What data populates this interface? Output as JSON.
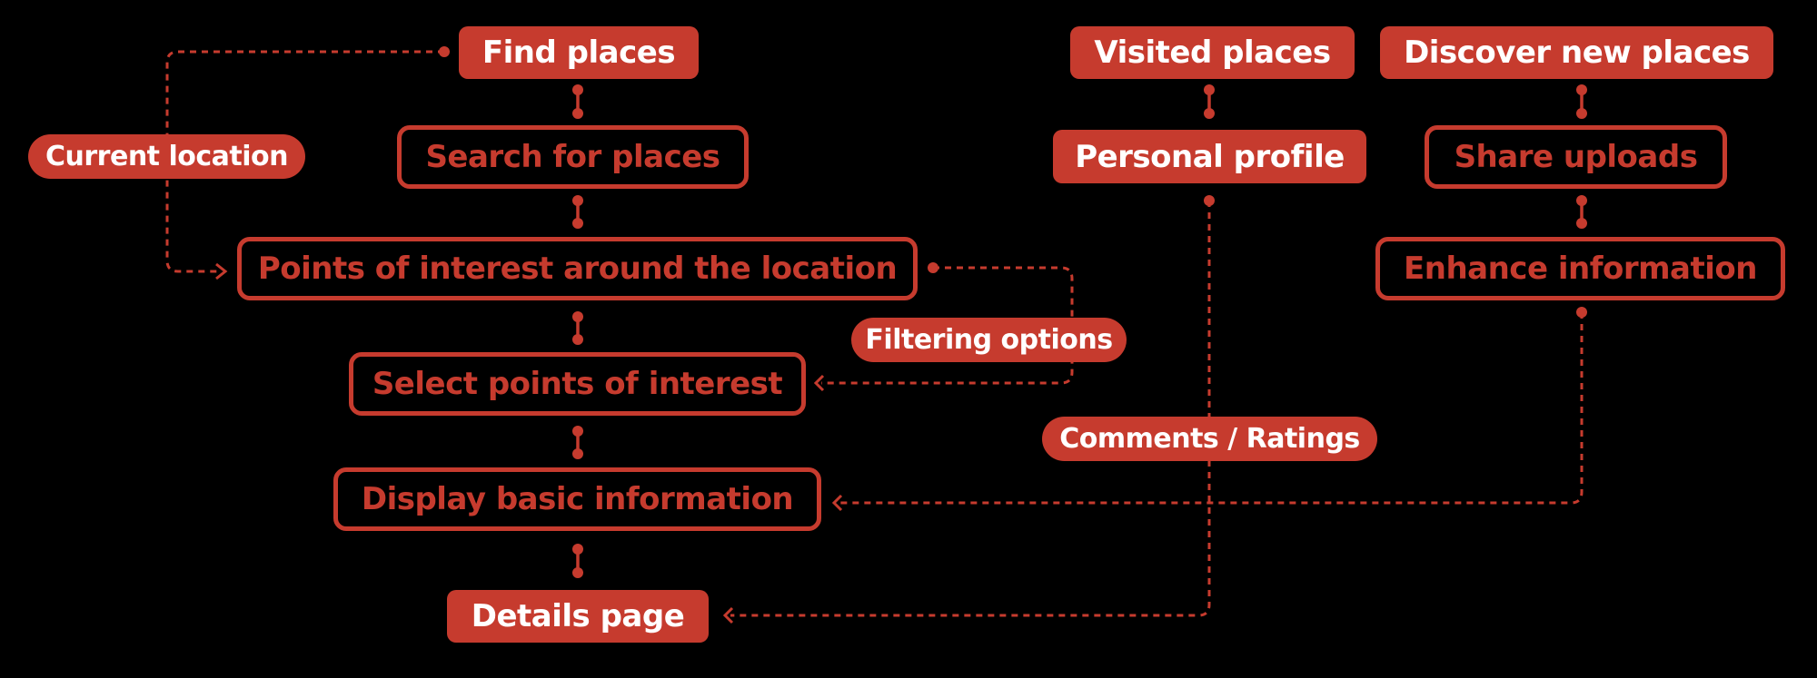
{
  "diagram": {
    "accent_color": "#c63b2e",
    "background_color": "#000000",
    "nodes": {
      "find_places": "Find places",
      "search_for_places": "Search for places",
      "points_of_interest": "Points of interest around the location",
      "select_points": "Select points of interest",
      "display_basic_info": "Display basic information",
      "details_page": "Details page",
      "visited_places": "Visited places",
      "personal_profile": "Personal profile",
      "discover_new_places": "Discover new places",
      "share_uploads": "Share uploads",
      "enhance_information": "Enhance information"
    },
    "labels": {
      "current_location": "Current location",
      "filtering_options": "Filtering options",
      "comments_ratings": "Comments / Ratings"
    },
    "edges": [
      {
        "from": "Find places",
        "to": "Search for places",
        "style": "solid"
      },
      {
        "from": "Search for places",
        "to": "Points of interest around the location",
        "style": "solid"
      },
      {
        "from": "Points of interest around the location",
        "to": "Select points of interest",
        "style": "solid"
      },
      {
        "from": "Select points of interest",
        "to": "Display basic information",
        "style": "solid"
      },
      {
        "from": "Display basic information",
        "to": "Details page",
        "style": "solid"
      },
      {
        "from": "Find places",
        "to": "Points of interest around the location",
        "style": "dashed",
        "label": "Current location"
      },
      {
        "from": "Points of interest around the location",
        "to": "Select points of interest",
        "style": "dashed",
        "label": "Filtering options"
      },
      {
        "from": "Visited places",
        "to": "Personal profile",
        "style": "solid"
      },
      {
        "from": "Personal profile",
        "to": "Details page",
        "style": "dashed",
        "label": "Comments / Ratings"
      },
      {
        "from": "Discover new places",
        "to": "Share uploads",
        "style": "solid"
      },
      {
        "from": "Share uploads",
        "to": "Enhance information",
        "style": "solid"
      },
      {
        "from": "Enhance information",
        "to": "Display basic information",
        "style": "dashed"
      }
    ]
  }
}
